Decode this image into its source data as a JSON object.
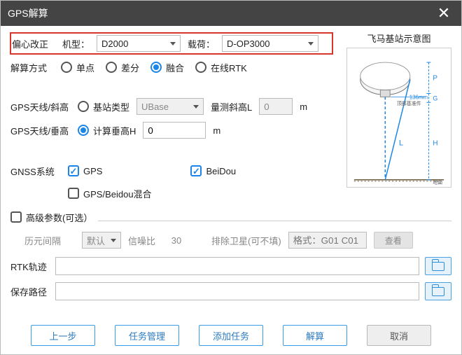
{
  "title": "GPS解算",
  "highlight": {
    "offset_label": "偏心改正",
    "model_label": "机型：",
    "model_value": "D2000",
    "payload_label": "载荷：",
    "payload_value": "D-OP3000"
  },
  "solve_mode": {
    "label": "解算方式",
    "single": "单点",
    "diff": "差分",
    "fusion": "融合",
    "rtk": "在线RTK"
  },
  "antenna_slant": {
    "label": "GPS天线/斜高",
    "base_type": "基站类型",
    "base_value": "UBase",
    "meas_label": "量测斜高L",
    "meas_value": "0",
    "unit": "m"
  },
  "antenna_vert": {
    "label": "GPS天线/垂高",
    "calc_label": "计算垂高H",
    "value": "0",
    "unit": "m"
  },
  "gnss": {
    "label": "GNSS系统",
    "gps": "GPS",
    "beidou": "BeiDou",
    "mix": "GPS/Beidou混合"
  },
  "adv_toggle": "高级参数(可选）",
  "adv": {
    "epoch_label": "历元间隔",
    "epoch_value": "默认",
    "snr_label": "信噪比",
    "snr_value": "30",
    "exclude_label": "排除卫星(可不填)",
    "exclude_placeholder": "格式：G01 C01 ...",
    "view": "查看"
  },
  "rtk_label": "RTK轨迹",
  "save_label": "保存路径",
  "buttons": {
    "prev": "上一步",
    "task_mgr": "任务管理",
    "add_task": "添加任务",
    "solve": "解算",
    "cancel": "取消"
  },
  "diagram_title": "飞马基站示意图"
}
